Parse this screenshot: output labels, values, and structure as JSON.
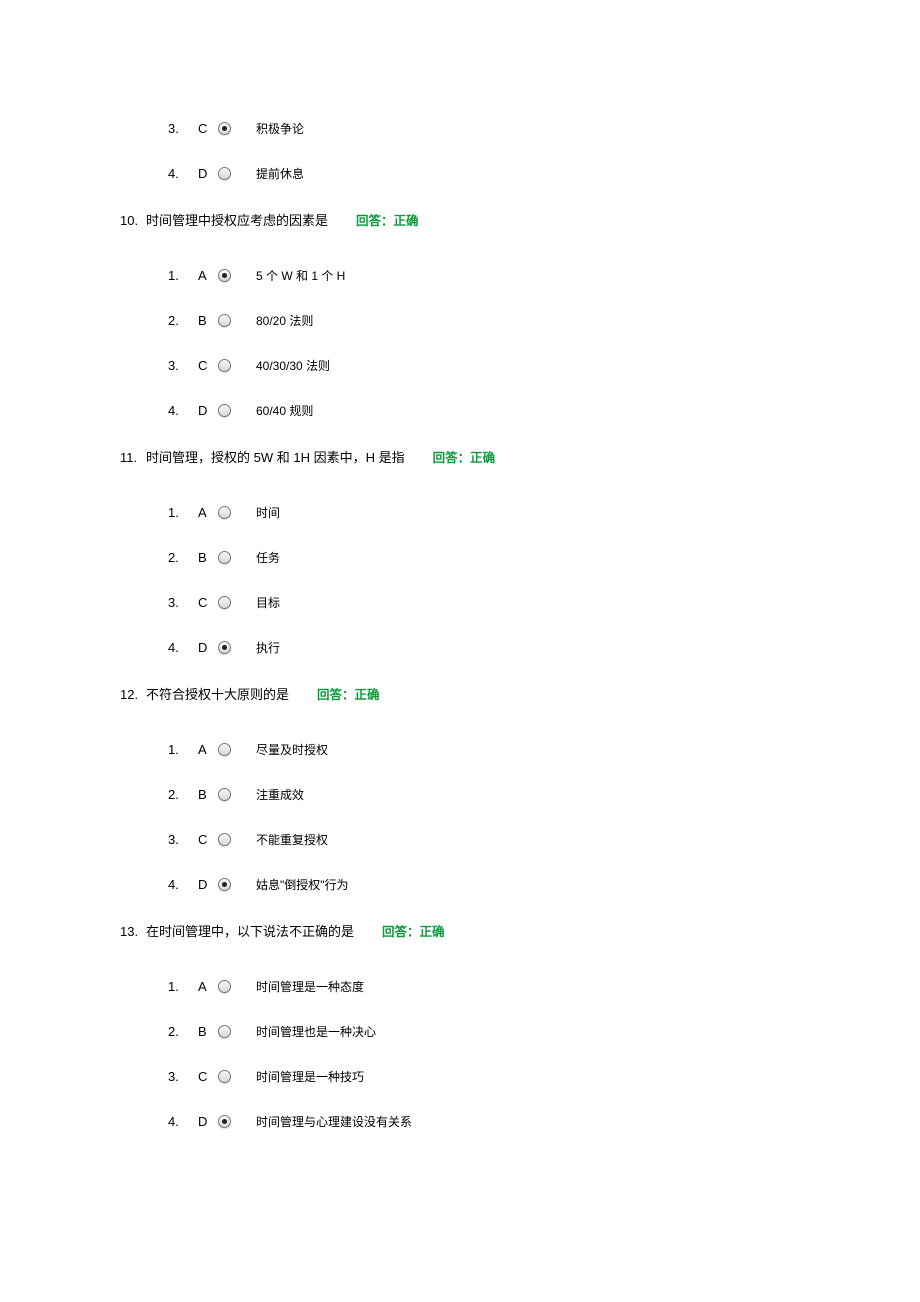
{
  "partial_options": [
    {
      "num": "3.",
      "letter": "C",
      "selected": true,
      "text": "积极争论"
    },
    {
      "num": "4.",
      "letter": "D",
      "selected": false,
      "text": "提前休息"
    }
  ],
  "questions": [
    {
      "num": "10.",
      "text": "时间管理中授权应考虑的因素是",
      "feedback": "回答：正确",
      "options": [
        {
          "num": "1.",
          "letter": "A",
          "selected": true,
          "text": "5 个 W 和 1 个 H"
        },
        {
          "num": "2.",
          "letter": "B",
          "selected": false,
          "text": "80/20 法则"
        },
        {
          "num": "3.",
          "letter": "C",
          "selected": false,
          "text": "40/30/30 法则"
        },
        {
          "num": "4.",
          "letter": "D",
          "selected": false,
          "text": "60/40 规则"
        }
      ]
    },
    {
      "num": "11.",
      "text": "时间管理，授权的 5W 和 1H 因素中，H 是指",
      "feedback": "回答：正确",
      "options": [
        {
          "num": "1.",
          "letter": "A",
          "selected": false,
          "text": "时间"
        },
        {
          "num": "2.",
          "letter": "B",
          "selected": false,
          "text": "任务"
        },
        {
          "num": "3.",
          "letter": "C",
          "selected": false,
          "text": "目标"
        },
        {
          "num": "4.",
          "letter": "D",
          "selected": true,
          "text": "执行"
        }
      ]
    },
    {
      "num": "12.",
      "text": "不符合授权十大原则的是",
      "feedback": "回答：正确",
      "options": [
        {
          "num": "1.",
          "letter": "A",
          "selected": false,
          "text": "尽量及时授权"
        },
        {
          "num": "2.",
          "letter": "B",
          "selected": false,
          "text": "注重成效"
        },
        {
          "num": "3.",
          "letter": "C",
          "selected": false,
          "text": "不能重复授权"
        },
        {
          "num": "4.",
          "letter": "D",
          "selected": true,
          "text": "姑息\"倒授权\"行为"
        }
      ]
    },
    {
      "num": "13.",
      "text": "在时间管理中，以下说法不正确的是",
      "feedback": "回答：正确",
      "options": [
        {
          "num": "1.",
          "letter": "A",
          "selected": false,
          "text": "时间管理是一种态度"
        },
        {
          "num": "2.",
          "letter": "B",
          "selected": false,
          "text": "时间管理也是一种决心"
        },
        {
          "num": "3.",
          "letter": "C",
          "selected": false,
          "text": "时间管理是一种技巧"
        },
        {
          "num": "4.",
          "letter": "D",
          "selected": true,
          "text": "时间管理与心理建设没有关系"
        }
      ]
    }
  ]
}
